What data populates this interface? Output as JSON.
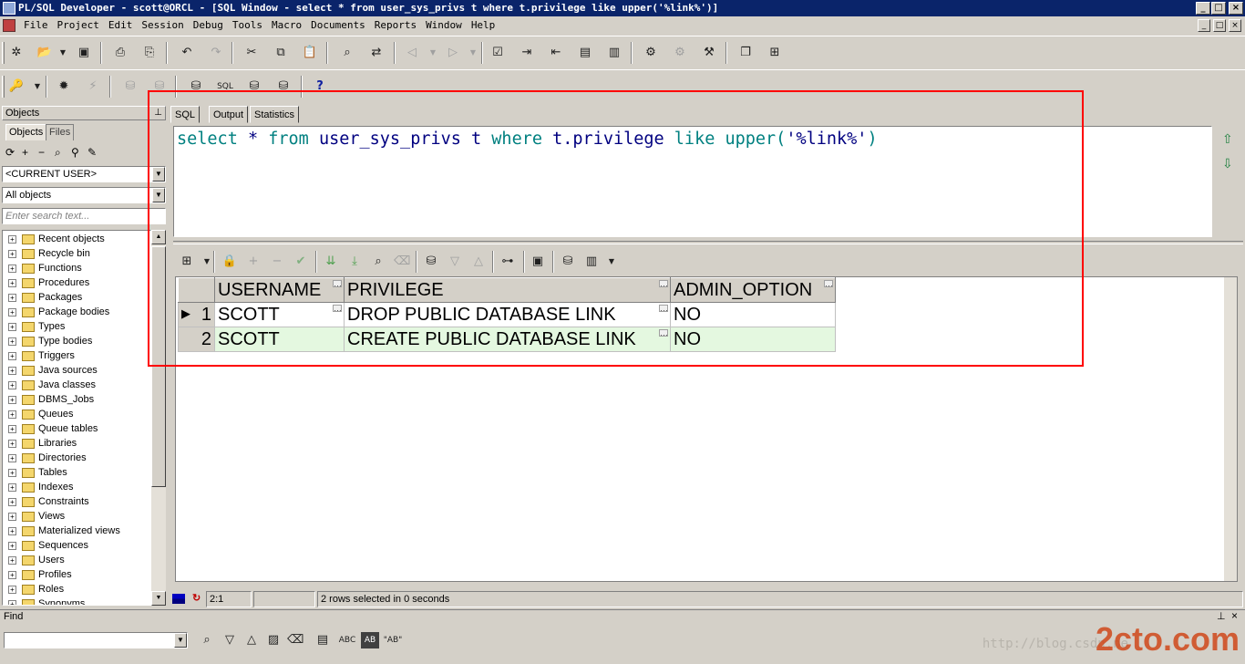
{
  "window": {
    "title": "PL/SQL Developer - scott@ORCL - [SQL Window - select * from user_sys_privs t where t.privilege like upper('%link%')]"
  },
  "menu": [
    "File",
    "Project",
    "Edit",
    "Session",
    "Debug",
    "Tools",
    "Macro",
    "Documents",
    "Reports",
    "Window",
    "Help"
  ],
  "left_panel": {
    "header": "Objects",
    "tabs": [
      "Objects",
      "Files"
    ],
    "user_combo": "<CURRENT USER>",
    "filter_combo": "All objects",
    "search_placeholder": "Enter search text...",
    "tree": [
      "Recent objects",
      "Recycle bin",
      "Functions",
      "Procedures",
      "Packages",
      "Package bodies",
      "Types",
      "Type bodies",
      "Triggers",
      "Java sources",
      "Java classes",
      "DBMS_Jobs",
      "Queues",
      "Queue tables",
      "Libraries",
      "Directories",
      "Tables",
      "Indexes",
      "Constraints",
      "Views",
      "Materialized views",
      "Sequences",
      "Users",
      "Profiles",
      "Roles",
      "Synonyms"
    ]
  },
  "sql_window": {
    "tabs": [
      "SQL",
      "Output",
      "Statistics"
    ],
    "sql": {
      "t1": "select",
      "t2": " * ",
      "t3": "from",
      "t4": " user_sys_privs t ",
      "t5": "where",
      "t6": " t.privilege ",
      "t7": "like",
      "t8": " upper(",
      "t9": "'%link%'",
      "t10": ")"
    }
  },
  "results": {
    "columns": [
      "USERNAME",
      "PRIVILEGE",
      "ADMIN_OPTION"
    ],
    "rows": [
      {
        "num": "1",
        "username": "SCOTT",
        "privilege": "DROP PUBLIC DATABASE LINK",
        "admin_option": "NO"
      },
      {
        "num": "2",
        "username": "SCOTT",
        "privilege": "CREATE PUBLIC DATABASE LINK",
        "admin_option": "NO"
      }
    ]
  },
  "status": {
    "position": "2:1",
    "message": "2 rows selected in 0 seconds"
  },
  "find": {
    "label": "Find",
    "abc": "ABC",
    "ab_quoted": "\"AB\""
  },
  "watermark": {
    "url": "http://blog.csdn.ne",
    "logo": "2cto.com"
  }
}
